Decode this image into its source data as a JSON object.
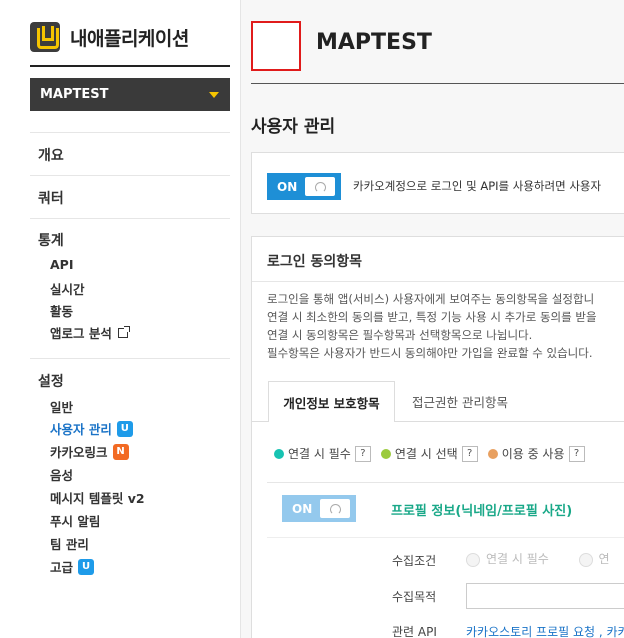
{
  "sidebar": {
    "brand_title": "내애플리케이션",
    "app_select": "MAPTEST",
    "groups": [
      {
        "label": "개요"
      },
      {
        "label": "쿼터"
      },
      {
        "label": "통계",
        "items": [
          {
            "label": "API"
          },
          {
            "label": "실시간"
          },
          {
            "label": "활동"
          },
          {
            "label": "앱로그 분석"
          }
        ]
      },
      {
        "label": "설정",
        "items": [
          {
            "label": "일반"
          },
          {
            "label": "사용자 관리",
            "badge": "U",
            "badge_color": "#1e9be9"
          },
          {
            "label": "카카오링크",
            "badge": "N",
            "badge_color": "#f26a23"
          },
          {
            "label": "음성"
          },
          {
            "label": "메시지 템플릿 v2"
          },
          {
            "label": "푸시 알림"
          },
          {
            "label": "팀 관리"
          },
          {
            "label": "고급",
            "badge": "U",
            "badge_color": "#1e9be9"
          }
        ]
      }
    ]
  },
  "main": {
    "app_name": "MAPTEST",
    "section_title": "사용자 관리",
    "toggle_on_label": "ON",
    "toggle_desc": "카카오계정으로 로그인 및 API를 사용하려면 사용자",
    "consent": {
      "title": "로그인 동의항목",
      "desc_lines": [
        "로그인을 통해 앱(서비스) 사용자에게 보여주는 동의항목을 설정합니",
        "연결 시 최소한의 동의를 받고, 특정 기능 사용 시 추가로 동의를 받을",
        "연결 시 동의항목은 필수항목과 선택항목으로 나뉩니다.",
        "필수항목은 사용자가 반드시 동의해야만 가입을 완료할 수 있습니다."
      ],
      "tabs": [
        {
          "label": "개인정보 보호항목",
          "active": true
        },
        {
          "label": "접근권한 관리항목",
          "active": false
        }
      ],
      "legend": [
        {
          "label": "연결 시 필수",
          "color": "#17c3b2"
        },
        {
          "label": "연결 시 선택",
          "color": "#9bcb3c"
        },
        {
          "label": "이용 중 사용",
          "color": "#e8a060"
        }
      ],
      "help_glyph": "?",
      "item": {
        "toggle_label": "ON",
        "name": "프로필 정보(닉네임/프로필 사진)",
        "collect_condition_label": "수집조건",
        "collect_condition_options": [
          "연결 시 필수",
          "연"
        ],
        "collect_purpose_label": "수집목적",
        "related_api_label": "관련 API",
        "related_api_value": "카카오스토리 프로필 요청 , 카카오"
      }
    }
  }
}
